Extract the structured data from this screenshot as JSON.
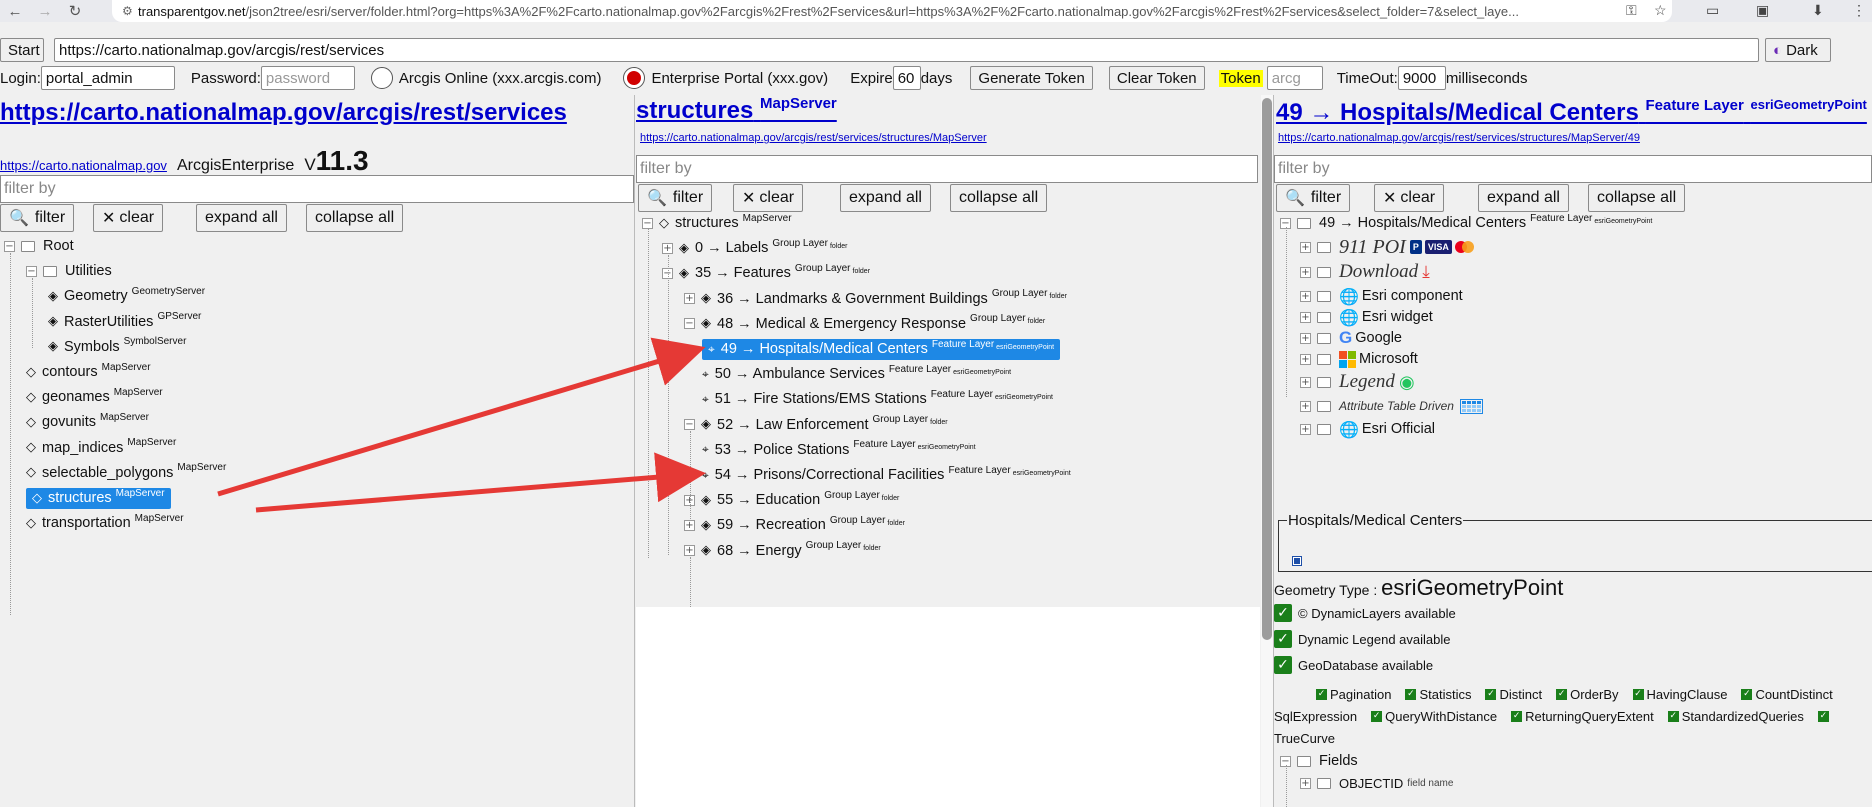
{
  "browser": {
    "url_host": "transparentgov.net",
    "url_path": "/json2tree/esri/server/folder.html?org=https%3A%2F%2Fcarto.nationalmap.gov%2Farcgis%2Frest%2Fservices&url=https%3A%2F%2Fcarto.nationalmap.gov%2Farcgis%2Frest%2Fservices&select_folder=7&select_laye..."
  },
  "toolbar": {
    "start_label": "Start",
    "service_url": "https://carto.nationalmap.gov/arcgis/rest/services",
    "dark_label": "Dark",
    "login_label": "Login:",
    "login_value": "portal_admin",
    "password_label": "Password:",
    "password_placeholder": "password",
    "arcgis_online_label": "Arcgis Online (xxx.arcgis.com)",
    "enterprise_label": "Enterprise Portal (xxx.gov)",
    "expire_label": "Expire",
    "expire_value": "60",
    "days_label": "days",
    "generate_label": "Generate Token",
    "clear_token_label": "Clear Token",
    "token_label": "Token",
    "token_placeholder": "arcg",
    "timeout_label": "TimeOut:",
    "timeout_value": "9000",
    "ms_label": "milliseconds"
  },
  "common": {
    "filter_placeholder": "filter by",
    "filter_btn": "filter",
    "clear_btn": "clear",
    "expand_btn": "expand all",
    "collapse_btn": "collapse all"
  },
  "panel1": {
    "title": "https://carto.nationalmap.gov/arcgis/rest/services",
    "host_link": "https://carto.nationalmap.gov",
    "server_type": "ArcgisEnterprise",
    "version_prefix": "V",
    "version": "11.3",
    "tree": [
      {
        "label": "Root",
        "sup": ""
      },
      {
        "label": "Utilities",
        "sup": ""
      },
      {
        "label": "Geometry",
        "sup": "GeometryServer"
      },
      {
        "label": "RasterUtilities",
        "sup": "GPServer"
      },
      {
        "label": "Symbols",
        "sup": "SymbolServer"
      },
      {
        "label": "contours",
        "sup": "MapServer"
      },
      {
        "label": "geonames",
        "sup": "MapServer"
      },
      {
        "label": "govunits",
        "sup": "MapServer"
      },
      {
        "label": "map_indices",
        "sup": "MapServer"
      },
      {
        "label": "selectable_polygons",
        "sup": "MapServer"
      },
      {
        "label": "structures",
        "sup": "MapServer"
      },
      {
        "label": "transportation",
        "sup": "MapServer"
      }
    ]
  },
  "panel2": {
    "title": "structures",
    "title_sup": "MapServer",
    "url": "https://carto.nationalmap.gov/arcgis/rest/services/structures/MapServer",
    "tree": [
      {
        "label": "structures",
        "sup": "MapServer",
        "sub": ""
      },
      {
        "label": "0 → Labels",
        "sup": "Group Layer",
        "sub": "folder"
      },
      {
        "label": "35 → Features",
        "sup": "Group Layer",
        "sub": "folder"
      },
      {
        "label": "36 → Landmarks & Government Buildings",
        "sup": "Group Layer",
        "sub": "folder"
      },
      {
        "label": "48 → Medical & Emergency Response",
        "sup": "Group Layer",
        "sub": "folder"
      },
      {
        "label": "49 → Hospitals/Medical Centers",
        "sup": "Feature Layer",
        "sub": "esriGeometryPoint"
      },
      {
        "label": "50 → Ambulance Services",
        "sup": "Feature Layer",
        "sub": "esriGeometryPoint"
      },
      {
        "label": "51 → Fire Stations/EMS Stations",
        "sup": "Feature Layer",
        "sub": "esriGeometryPoint"
      },
      {
        "label": "52 → Law Enforcement",
        "sup": "Group Layer",
        "sub": "folder"
      },
      {
        "label": "53 → Police Stations",
        "sup": "Feature Layer",
        "sub": "esriGeometryPoint"
      },
      {
        "label": "54 → Prisons/Correctional Facilities",
        "sup": "Feature Layer",
        "sub": "esriGeometryPoint"
      },
      {
        "label": "55 → Education",
        "sup": "Group Layer",
        "sub": "folder"
      },
      {
        "label": "59 → Recreation",
        "sup": "Group Layer",
        "sub": "folder"
      },
      {
        "label": "68 → Energy",
        "sup": "Group Layer",
        "sub": "folder"
      }
    ]
  },
  "panel3": {
    "title": "49 → Hospitals/Medical Centers",
    "title_sup": "Feature Layer",
    "title_sup2": "esriGeometryPoint",
    "url": "https://carto.nationalmap.gov/arcgis/rest/services/structures/MapServer/49",
    "tree_root": {
      "label": "49 → Hospitals/Medical Centers",
      "sup": "Feature Layer",
      "sub": "esriGeometryPoint"
    },
    "apps": [
      "911 POI",
      "Download",
      "Esri component",
      "Esri widget",
      "Google",
      "Microsoft",
      "Legend",
      "Attribute Table Driven",
      "Esri Official"
    ],
    "badges": {
      "visa": "VISA",
      "paypal": "P"
    },
    "legend_title": "Hospitals/Medical Centers",
    "geometry_label": "Geometry Type :",
    "geometry_value": "esriGeometryPoint",
    "checks": [
      "© DynamicLayers available",
      "Dynamic Legend available",
      "GeoDatabase available"
    ],
    "caps_row1": [
      "Pagination",
      "Statistics",
      "Distinct",
      "OrderBy",
      "HavingClause",
      "CountDistinct"
    ],
    "caps_row2_prefix": "SqlExpression",
    "caps_row2": [
      "QueryWithDistance",
      "ReturningQueryExtent",
      "StandardizedQueries"
    ],
    "caps_row3": "TrueCurve",
    "fields_label": "Fields",
    "field_name": "OBJECTID",
    "field_sub": "field name"
  },
  "colors": {
    "link": "#0000cc",
    "selected": "#1e88e5",
    "arrow": "#e53935",
    "check": "#1a7f1a",
    "token_highlight": "#ffff00"
  }
}
